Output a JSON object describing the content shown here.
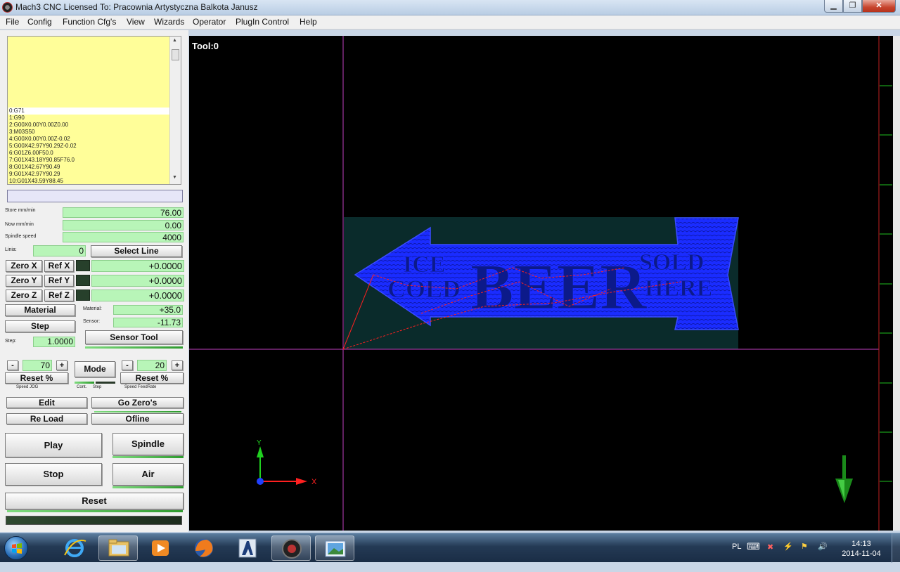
{
  "window": {
    "title": "Mach3 CNC  Licensed To: Pracownia Artystyczna Balkota Janusz"
  },
  "menu": [
    "File",
    "Config",
    "Function Cfg's",
    "View",
    "Wizards",
    "Operator",
    "PlugIn Control",
    "Help"
  ],
  "gcode": {
    "lines": [
      "0:G71",
      "1:G90",
      "2:G00X0.00Y0.00Z0.00",
      "3:M03S50",
      "4:G00X0.00Y0.00Z-0.02",
      "5:G00X42.97Y90.29Z-0.02",
      "6:G01Z6.00F50.0",
      "7:G01X43.18Y90.85F76.0",
      "8:G01X42.67Y90.49",
      "9:G01X42.97Y90.29",
      "10:G01X43.59Y88.45"
    ],
    "current_line": 0
  },
  "readouts": {
    "store_label": "Store mm/min",
    "store_value": "76.00",
    "now_label": "Now mm/min",
    "now_value": "0.00",
    "spindle_label": "Spindle speed",
    "spindle_value": "4000",
    "linia_label": "Linia:",
    "linia_value": "0"
  },
  "buttons": {
    "select_line": "Select Line",
    "zero_x": "Zero X",
    "ref_x": "Ref X",
    "zero_y": "Zero Y",
    "ref_y": "Ref Y",
    "zero_z": "Zero Z",
    "ref_z": "Ref Z",
    "material": "Material",
    "step": "Step",
    "sensor_tool": "Sensor Tool",
    "mode": "Mode",
    "reset_jog": "Reset  %",
    "reset_feed": "Reset  %",
    "minus": "-",
    "plus": "+",
    "edit": "Edit",
    "go_zeros": "Go Zero's",
    "reload": "Re Load",
    "offline": "Ofline",
    "play": "Play",
    "spindle": "Spindle",
    "stop": "Stop",
    "air": "Air",
    "reset": "Reset"
  },
  "axes": {
    "x": "+0.0000",
    "y": "+0.0000",
    "z": "+0.0000"
  },
  "material": {
    "material_label": "Material:",
    "material_value": "+35.0",
    "sensor_label": "Sensor:",
    "sensor_value": "-11.73"
  },
  "step": {
    "label": "Step:",
    "value": "1.0000"
  },
  "jog": {
    "value": "70",
    "label": "Speed JOG"
  },
  "feed": {
    "value": "20",
    "label": "Speed FeedRate"
  },
  "mode_labels": {
    "cont": "Cont.",
    "step": "Step"
  },
  "toolpath": {
    "tool_label": "Tool:0",
    "sign_text": [
      "ICE",
      "COLD",
      "BEER",
      "SOLD",
      "HERE"
    ],
    "colors": {
      "background": "#000000",
      "stock": "#0a2b2b",
      "path": "#1a2cff",
      "rapid": "#ff2020",
      "axis_line": "#c040c0"
    }
  },
  "taskbar": {
    "apps": [
      "start-button",
      "internet-explorer",
      "windows-explorer",
      "media-player",
      "firefox",
      "artcam",
      "mach3",
      "image-viewer"
    ],
    "language": "PL",
    "time": "14:13",
    "date": "2014-11-04"
  }
}
